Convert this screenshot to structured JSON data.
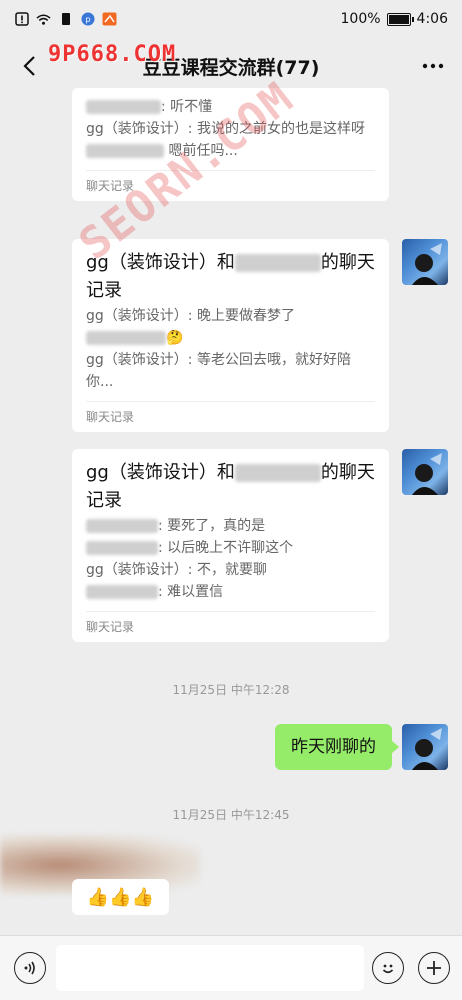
{
  "status_bar": {
    "battery_text": "100%",
    "battery_level": 1.0,
    "time": "4:06"
  },
  "watermarks": {
    "top": "9P668.COM",
    "diagonal": "SEORN.COM"
  },
  "nav": {
    "title": "豆豆课程交流群(77)"
  },
  "messages": {
    "card1": {
      "line1": ": 听不懂",
      "line2": "gg（装饰设计）: 我说的之前女的也是这样呀",
      "line3": " 嗯前任吗...",
      "footer": "聊天记录"
    },
    "card2": {
      "title_pre": "gg（装饰设计）和",
      "title_post": "的聊天记录",
      "line1": "gg（装饰设计）: 晚上要做春梦了",
      "line2_emoji": "🤔",
      "line3": "gg（装饰设计）: 等老公回去哦，就好好陪你...",
      "footer": "聊天记录"
    },
    "card3": {
      "title_pre": "gg（装饰设计）和",
      "title_post": "的聊天记录",
      "line1": ": 要死了，真的是",
      "line2": ": 以后晚上不许聊这个",
      "line3": "gg（装饰设计）: 不，就要聊",
      "line4": ": 难以置信",
      "footer": "聊天记录"
    },
    "timestamp1": "11月25日 中午12:28",
    "my_message": "昨天刚聊的",
    "timestamp2": "11月25日 中午12:45",
    "thumbs": "👍👍👍"
  },
  "icons": {
    "back": "chevron-left-icon",
    "more": "more-dots-icon",
    "voice": "voice-icon",
    "emoji": "emoji-icon",
    "plus": "plus-icon"
  }
}
